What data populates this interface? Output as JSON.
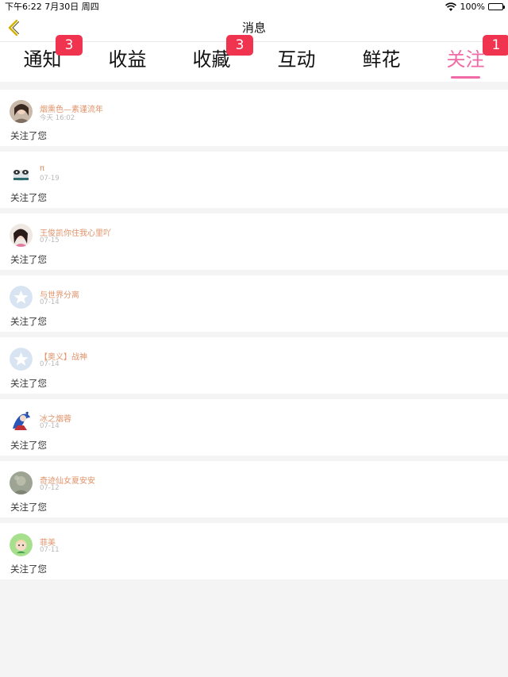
{
  "status_bar": {
    "time_date": "下午6:22   7月30日 周四",
    "battery_text": "100%",
    "battery_level": 1.0
  },
  "nav": {
    "title": "消息",
    "back_icon": "chevron-left-icon"
  },
  "tabs": [
    {
      "label": "通知",
      "badge": "3",
      "active": false
    },
    {
      "label": "收益",
      "badge": "",
      "active": false
    },
    {
      "label": "收藏",
      "badge": "3",
      "active": false
    },
    {
      "label": "互动",
      "badge": "",
      "active": false
    },
    {
      "label": "鲜花",
      "badge": "",
      "active": false
    },
    {
      "label": "关注",
      "badge": "1",
      "active": true
    }
  ],
  "colors": {
    "accent": "#f06aa5",
    "badge": "#f0334f",
    "username": "#e0936a",
    "back_icon": "#d4b000"
  },
  "notifications": [
    {
      "name": "烟熏色—素谨流年",
      "time": "今天 16:02",
      "message": "关注了您",
      "avatar": "photo-avatar-girl"
    },
    {
      "name": "π",
      "time": "07-19",
      "message": "关注了您",
      "avatar": "cartoon-panda-avatar"
    },
    {
      "name": "王俊凯你住我心里吖",
      "time": "07-15",
      "message": "关注了您",
      "avatar": "photo-avatar-girl"
    },
    {
      "name": "与世界分离",
      "time": "07-14",
      "message": "关注了您",
      "avatar": "default-star-avatar"
    },
    {
      "name": "【奥义】战神",
      "time": "07-14",
      "message": "关注了您",
      "avatar": "default-star-avatar"
    },
    {
      "name": "冰之烟蓉",
      "time": "07-14",
      "message": "关注了您",
      "avatar": "anime-blue-avatar"
    },
    {
      "name": "奇迹仙女夏安安",
      "time": "07-12",
      "message": "关注了您",
      "avatar": "photo-avatar-grey"
    },
    {
      "name": "菲美",
      "time": "07-11",
      "message": "关注了您",
      "avatar": "anime-green-avatar"
    }
  ]
}
